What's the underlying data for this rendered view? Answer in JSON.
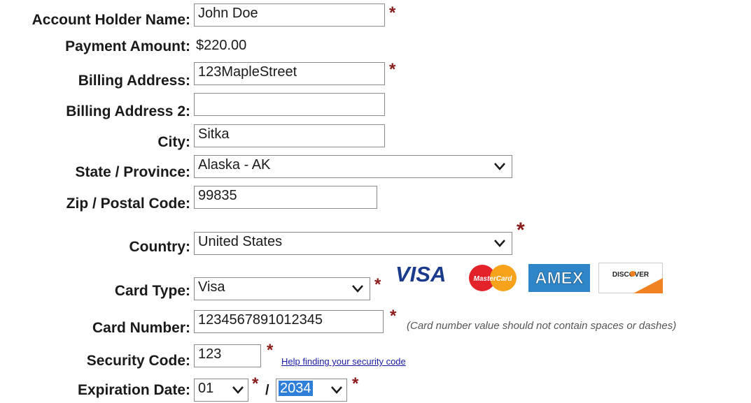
{
  "form": {
    "account_holder": {
      "label": "Account Holder Name:",
      "value": "John Doe"
    },
    "payment_amount": {
      "label": "Payment Amount:",
      "value": "$220.00"
    },
    "billing_address": {
      "label": "Billing Address:",
      "value": "123MapleStreet"
    },
    "billing_address_2": {
      "label": "Billing Address 2:",
      "value": ""
    },
    "city": {
      "label": "City:",
      "value": "Sitka"
    },
    "state": {
      "label": "State / Province:",
      "value": "Alaska - AK"
    },
    "zip": {
      "label": "Zip / Postal Code:",
      "value": "99835"
    },
    "country": {
      "label": "Country:",
      "value": "United States"
    },
    "card_type": {
      "label": "Card Type:",
      "value": "Visa"
    },
    "card_number": {
      "label": "Card Number:",
      "value": "1234567891012345",
      "note": "(Card number value should not contain spaces or dashes)"
    },
    "security_code": {
      "label": "Security Code:",
      "value": "123",
      "help_link": "Help finding your security code"
    },
    "expiration": {
      "label": "Expiration Date:",
      "month": "01",
      "separator": "/",
      "year": "2034"
    },
    "required_marker": "*"
  },
  "card_logos": {
    "visa": "VISA",
    "mastercard": "MasterCard",
    "amex": "AMEX",
    "discover": "DISCOVER"
  },
  "colors": {
    "required": "#8b1a1a",
    "link": "#1a1aa8",
    "selection": "#2f7fd8",
    "border": "#8a8a8a"
  }
}
